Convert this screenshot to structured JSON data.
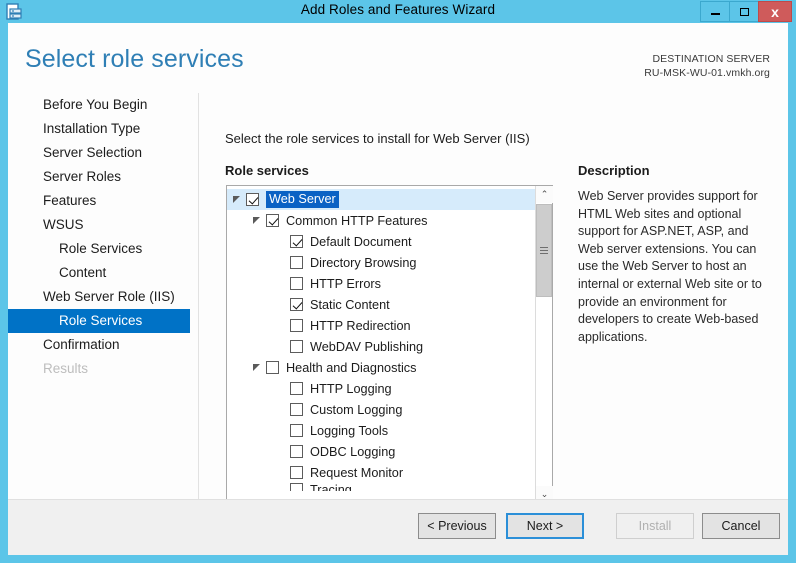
{
  "window": {
    "title": "Add Roles and Features Wizard",
    "icon": "server-wizard-icon",
    "minimize_label": "Minimize",
    "maximize_label": "Maximize",
    "close_label": "x"
  },
  "header": {
    "page_title": "Select role services",
    "destination_label": "DESTINATION SERVER",
    "destination_server": "RU-MSK-WU-01.vmkh.org"
  },
  "sidebar": {
    "items": [
      {
        "label": "Before You Begin",
        "state": "normal",
        "indent": 0
      },
      {
        "label": "Installation Type",
        "state": "normal",
        "indent": 0
      },
      {
        "label": "Server Selection",
        "state": "normal",
        "indent": 0
      },
      {
        "label": "Server Roles",
        "state": "normal",
        "indent": 0
      },
      {
        "label": "Features",
        "state": "normal",
        "indent": 0
      },
      {
        "label": "WSUS",
        "state": "normal",
        "indent": 0
      },
      {
        "label": "Role Services",
        "state": "normal",
        "indent": 1
      },
      {
        "label": "Content",
        "state": "normal",
        "indent": 1
      },
      {
        "label": "Web Server Role (IIS)",
        "state": "normal",
        "indent": 0
      },
      {
        "label": "Role Services",
        "state": "selected",
        "indent": 1
      },
      {
        "label": "Confirmation",
        "state": "normal",
        "indent": 0
      },
      {
        "label": "Results",
        "state": "disabled",
        "indent": 0
      }
    ]
  },
  "main": {
    "instruction": "Select the role services to install for Web Server (IIS)",
    "role_services_label": "Role services",
    "description_label": "Description",
    "description_text": "Web Server provides support for HTML Web sites and optional support for ASP.NET, ASP, and Web server extensions. You can use the Web Server to host an internal or external Web site or to provide an environment for developers to create Web-based applications.",
    "tree": [
      {
        "label": "Web Server",
        "level": 0,
        "checked": true,
        "expander": "expanded",
        "selected": true
      },
      {
        "label": "Common HTTP Features",
        "level": 1,
        "checked": true,
        "expander": "expanded",
        "selected": false
      },
      {
        "label": "Default Document",
        "level": 2,
        "checked": true,
        "expander": "none",
        "selected": false
      },
      {
        "label": "Directory Browsing",
        "level": 2,
        "checked": false,
        "expander": "none",
        "selected": false
      },
      {
        "label": "HTTP Errors",
        "level": 2,
        "checked": false,
        "expander": "none",
        "selected": false
      },
      {
        "label": "Static Content",
        "level": 2,
        "checked": true,
        "expander": "none",
        "selected": false
      },
      {
        "label": "HTTP Redirection",
        "level": 2,
        "checked": false,
        "expander": "none",
        "selected": false
      },
      {
        "label": "WebDAV Publishing",
        "level": 2,
        "checked": false,
        "expander": "none",
        "selected": false
      },
      {
        "label": "Health and Diagnostics",
        "level": 1,
        "checked": false,
        "expander": "expanded",
        "selected": false
      },
      {
        "label": "HTTP Logging",
        "level": 2,
        "checked": false,
        "expander": "none",
        "selected": false
      },
      {
        "label": "Custom Logging",
        "level": 2,
        "checked": false,
        "expander": "none",
        "selected": false
      },
      {
        "label": "Logging Tools",
        "level": 2,
        "checked": false,
        "expander": "none",
        "selected": false
      },
      {
        "label": "ODBC Logging",
        "level": 2,
        "checked": false,
        "expander": "none",
        "selected": false
      },
      {
        "label": "Request Monitor",
        "level": 2,
        "checked": false,
        "expander": "none",
        "selected": false
      },
      {
        "label": "Tracing",
        "level": 2,
        "checked": false,
        "expander": "none",
        "selected": false,
        "clipped": true
      }
    ],
    "scrollbars": {
      "vertical_up": "⌃",
      "vertical_down": "⌄",
      "horizontal_left": "‹",
      "horizontal_right": "›"
    }
  },
  "footer": {
    "previous_label": "< Previous",
    "next_label": "Next >",
    "install_label": "Install",
    "cancel_label": "Cancel"
  }
}
